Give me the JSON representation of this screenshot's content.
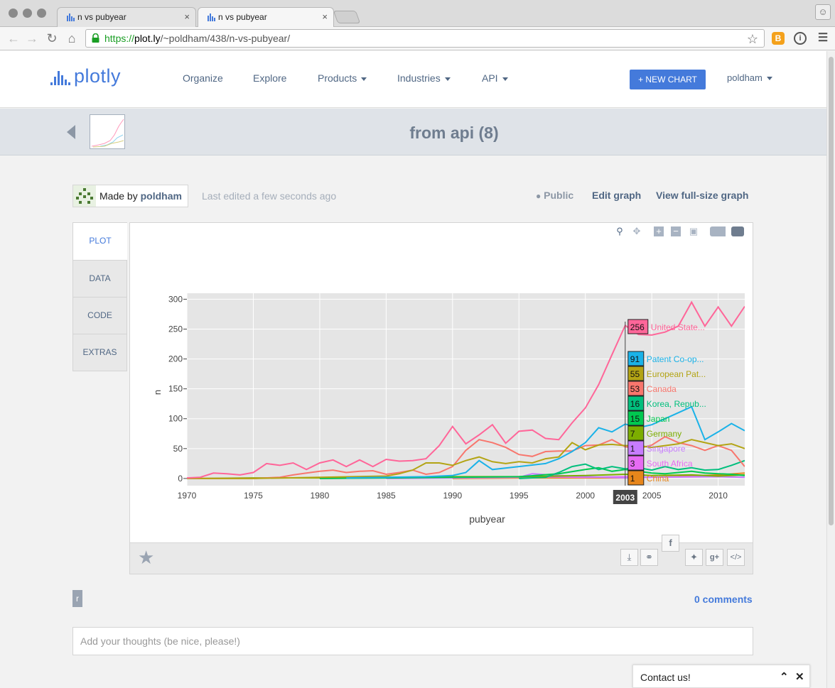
{
  "browser": {
    "tabs": [
      {
        "title": "n vs pubyear",
        "active": false
      },
      {
        "title": "n vs pubyear",
        "active": true
      }
    ],
    "url": {
      "scheme": "https://",
      "host": "plot.ly",
      "path": "/~poldham/438/n-vs-pubyear/"
    },
    "tab_close": "×",
    "nav": {
      "back": "←",
      "forward": "→",
      "reload": "↻",
      "home": "⌂"
    }
  },
  "nav": {
    "brand": "plotly",
    "links": [
      {
        "label": "Organize",
        "dropdown": false
      },
      {
        "label": "Explore",
        "dropdown": false
      },
      {
        "label": "Products",
        "dropdown": true
      },
      {
        "label": "Industries",
        "dropdown": true
      },
      {
        "label": "API",
        "dropdown": true
      }
    ],
    "new_chart": "+ NEW CHART",
    "user": "poldham"
  },
  "graph": {
    "title": "from api (8)",
    "made_by_prefix": "Made by",
    "author": "poldham",
    "last_edited": "Last edited a few seconds ago",
    "visibility": "Public",
    "edit_link": "Edit graph",
    "fullsize_link": "View full-size graph"
  },
  "side_tabs": [
    "PLOT",
    "DATA",
    "CODE",
    "EXTRAS"
  ],
  "footer": {
    "r_badge": "r",
    "comments": "0 comments",
    "thoughts_placeholder": "Add your thoughts (be nice, please!)",
    "contact": "Contact us!"
  },
  "chart_data": {
    "type": "line",
    "title": "",
    "xlabel": "pubyear",
    "ylabel": "n",
    "xlim": [
      1970,
      2012
    ],
    "ylim": [
      -12,
      310
    ],
    "xticks": [
      1970,
      1975,
      1980,
      1985,
      1990,
      1995,
      2000,
      2005,
      2010
    ],
    "yticks": [
      0,
      50,
      100,
      150,
      200,
      250,
      300
    ],
    "grid": true,
    "plot_background": "#e5e5e5",
    "hover": {
      "x_label": "2003",
      "items": [
        {
          "value": "256",
          "name": "United State...",
          "color": "#ff6699"
        },
        {
          "value": "91",
          "name": "Patent Co-op...",
          "color": "#1ab2e8"
        },
        {
          "value": "55",
          "name": "European Pat...",
          "color": "#b3a414"
        },
        {
          "value": "53",
          "name": "Canada",
          "color": "#f8766d"
        },
        {
          "value": "16",
          "name": "Korea, Repub...",
          "color": "#00bf7d"
        },
        {
          "value": "15",
          "name": "Japan",
          "color": "#00c850"
        },
        {
          "value": "7",
          "name": "Germany",
          "color": "#7cae00"
        },
        {
          "value": "1",
          "name": "Singapore",
          "color": "#c77cff"
        },
        {
          "value": "3",
          "name": "South Africa",
          "color": "#e76bf3"
        },
        {
          "value": "1",
          "name": "China",
          "color": "#e7861b"
        }
      ]
    },
    "series": [
      {
        "name": "United State...",
        "color": "#ff6699",
        "x": [
          1970,
          1971,
          1972,
          1973,
          1974,
          1975,
          1976,
          1977,
          1978,
          1979,
          1980,
          1981,
          1982,
          1983,
          1984,
          1985,
          1986,
          1987,
          1988,
          1989,
          1990,
          1991,
          1992,
          1993,
          1994,
          1995,
          1996,
          1997,
          1998,
          1999,
          2000,
          2001,
          2002,
          2003,
          2004,
          2005,
          2006,
          2007,
          2008,
          2009,
          2010,
          2011,
          2012
        ],
        "y": [
          1,
          2,
          9,
          8,
          6,
          10,
          25,
          22,
          26,
          15,
          26,
          31,
          20,
          31,
          20,
          32,
          29,
          30,
          33,
          55,
          87,
          58,
          73,
          90,
          59,
          79,
          81,
          67,
          65,
          93,
          118,
          157,
          207,
          256,
          241,
          240,
          245,
          255,
          295,
          255,
          287,
          255,
          288
        ]
      },
      {
        "name": "Patent Co-op...",
        "color": "#1ab2e8",
        "x": [
          1982,
          1985,
          1988,
          1990,
          1991,
          1992,
          1993,
          1995,
          1997,
          1998,
          1999,
          2000,
          2001,
          2002,
          2003,
          2004,
          2005,
          2006,
          2007,
          2008,
          2009,
          2010,
          2011,
          2012
        ],
        "y": [
          1,
          2,
          3,
          5,
          10,
          30,
          15,
          20,
          25,
          33,
          45,
          60,
          85,
          78,
          91,
          85,
          90,
          100,
          110,
          120,
          65,
          78,
          92,
          80
        ]
      },
      {
        "name": "European Pat...",
        "color": "#b3a414",
        "x": [
          1970,
          1975,
          1980,
          1985,
          1986,
          1987,
          1988,
          1989,
          1990,
          1991,
          1992,
          1993,
          1994,
          1995,
          1996,
          1997,
          1998,
          1999,
          2000,
          2001,
          2002,
          2003,
          2004,
          2005,
          2006,
          2007,
          2008,
          2009,
          2010,
          2011,
          2012
        ],
        "y": [
          0,
          0,
          2,
          4,
          8,
          14,
          26,
          26,
          22,
          30,
          36,
          28,
          25,
          28,
          26,
          33,
          36,
          60,
          48,
          56,
          57,
          55,
          55,
          52,
          55,
          58,
          65,
          60,
          55,
          58,
          50
        ]
      },
      {
        "name": "Canada",
        "color": "#f8766d",
        "x": [
          1970,
          1975,
          1977,
          1978,
          1979,
          1980,
          1981,
          1982,
          1983,
          1984,
          1985,
          1986,
          1987,
          1988,
          1989,
          1990,
          1991,
          1992,
          1993,
          1994,
          1995,
          1996,
          1997,
          1998,
          1999,
          2000,
          2001,
          2002,
          2003,
          2004,
          2005,
          2006,
          2007,
          2008,
          2009,
          2010,
          2011,
          2012
        ],
        "y": [
          0,
          0,
          2,
          6,
          9,
          12,
          14,
          10,
          12,
          13,
          7,
          10,
          14,
          7,
          10,
          20,
          47,
          65,
          60,
          52,
          40,
          37,
          45,
          46,
          46,
          55,
          56,
          65,
          53,
          50,
          56,
          70,
          60,
          55,
          47,
          55,
          47,
          20
        ]
      },
      {
        "name": "Korea, Repub...",
        "color": "#00bf7d",
        "x": [
          1995,
          1997,
          1998,
          1999,
          2000,
          2001,
          2002,
          2003,
          2004,
          2005,
          2006,
          2007,
          2008,
          2009,
          2010,
          2011,
          2012
        ],
        "y": [
          0,
          2,
          10,
          20,
          24,
          15,
          20,
          16,
          18,
          14,
          20,
          15,
          18,
          14,
          15,
          22,
          30
        ]
      },
      {
        "name": "Japan",
        "color": "#00c850",
        "x": [
          1980,
          1985,
          1990,
          1995,
          1998,
          2000,
          2001,
          2002,
          2003,
          2004,
          2005,
          2006,
          2007,
          2008,
          2009,
          2010,
          2011,
          2012
        ],
        "y": [
          0,
          1,
          2,
          3,
          8,
          15,
          18,
          12,
          15,
          12,
          9,
          8,
          10,
          12,
          9,
          8,
          7,
          5
        ]
      },
      {
        "name": "Germany",
        "color": "#7cae00",
        "x": [
          1971,
          1975,
          1980,
          1985,
          1990,
          1995,
          2000,
          2003,
          2005,
          2008,
          2010,
          2012
        ],
        "y": [
          0,
          1,
          1,
          2,
          3,
          3,
          5,
          7,
          5,
          6,
          4,
          6
        ]
      },
      {
        "name": "Singapore",
        "color": "#c77cff",
        "x": [
          1985,
          1990,
          1995,
          1996,
          1998,
          2000,
          2003,
          2005,
          2008,
          2010,
          2012
        ],
        "y": [
          0,
          1,
          2,
          8,
          5,
          3,
          1,
          2,
          3,
          3,
          2
        ]
      },
      {
        "name": "South Africa",
        "color": "#e76bf3",
        "x": [
          1980,
          1985,
          1990,
          1995,
          2000,
          2003,
          2005,
          2010,
          2012
        ],
        "y": [
          0,
          1,
          2,
          3,
          2,
          3,
          2,
          3,
          2
        ]
      },
      {
        "name": "China",
        "color": "#e7861b",
        "x": [
          1990,
          1995,
          2000,
          2003,
          2005,
          2008,
          2010,
          2012
        ],
        "y": [
          0,
          1,
          1,
          1,
          2,
          4,
          6,
          9
        ]
      }
    ]
  }
}
